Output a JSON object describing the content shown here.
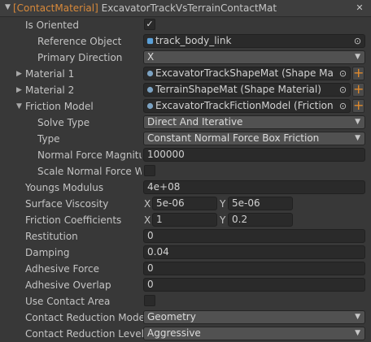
{
  "header": {
    "type_label": "[ContactMaterial]",
    "name": "ExcavatorTrackVsTerrainContactMat",
    "close_glyph": "✕"
  },
  "rows": {
    "is_oriented": {
      "label": "Is Oriented",
      "checked": true,
      "check_glyph": "✓"
    },
    "reference_object": {
      "label": "Reference Object",
      "value": "track_body_link",
      "icon": "rigidbody-icon"
    },
    "primary_direction": {
      "label": "Primary Direction",
      "value": "X"
    },
    "material1": {
      "label": "Material 1",
      "value": "ExcavatorTrackShapeMat (Shape Mate",
      "icon": "shape-material-icon"
    },
    "material2": {
      "label": "Material 2",
      "value": "TerrainShapeMat (Shape Material)",
      "icon": "shape-material-icon"
    },
    "friction_model": {
      "label": "Friction Model",
      "value": "ExcavatorTrackFictionModel (Friction M",
      "icon": "friction-model-icon"
    },
    "solve_type": {
      "label": "Solve Type",
      "value": "Direct And Iterative"
    },
    "type": {
      "label": "Type",
      "value": "Constant Normal Force Box Friction"
    },
    "normal_force_magnitude": {
      "label": "Normal Force Magnitud",
      "value": "100000"
    },
    "scale_normal_force": {
      "label": "Scale Normal Force Wi",
      "checked": false
    },
    "youngs_modulus": {
      "label": "Youngs Modulus",
      "value": "4e+08"
    },
    "surface_viscosity": {
      "label": "Surface Viscosity",
      "x_label": "X",
      "x": "5e-06",
      "y_label": "Y",
      "y": "5e-06"
    },
    "friction_coefficients": {
      "label": "Friction Coefficients",
      "x_label": "X",
      "x": "1",
      "y_label": "Y",
      "y": "0.2"
    },
    "restitution": {
      "label": "Restitution",
      "value": "0"
    },
    "damping": {
      "label": "Damping",
      "value": "0.04"
    },
    "adhesive_force": {
      "label": "Adhesive Force",
      "value": "0"
    },
    "adhesive_overlap": {
      "label": "Adhesive Overlap",
      "value": "0"
    },
    "use_contact_area": {
      "label": "Use Contact Area",
      "checked": false
    },
    "contact_reduction_mode": {
      "label": "Contact Reduction Mode",
      "value": "Geometry"
    },
    "contact_reduction_level": {
      "label": "Contact Reduction Level",
      "value": "Aggressive"
    }
  },
  "glyphs": {
    "arrow_down": "▼",
    "arrow_right": "▶",
    "caret": "▼",
    "picker": "⊙",
    "plus": "+"
  },
  "colors": {
    "accent_orange": "#d8893a",
    "plus_orange": "#e08a2c",
    "background": "#383838",
    "field_bg": "#2a2a2a",
    "dropdown_bg": "#515151"
  }
}
